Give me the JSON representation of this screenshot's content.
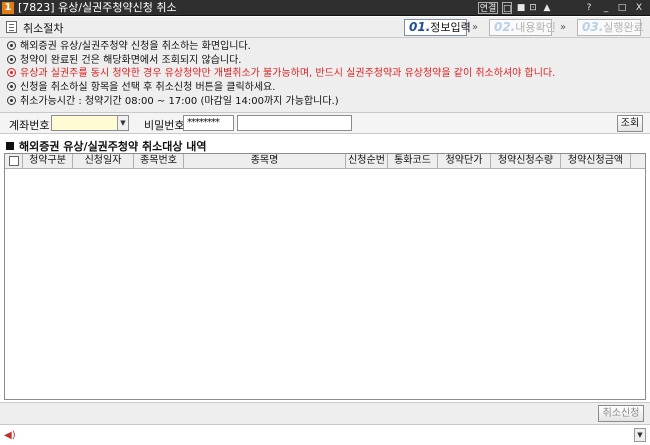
{
  "window": {
    "badge": "1",
    "title": "[7823] 유상/실권주청약신청 취소",
    "controls": [
      "연결",
      "□",
      "■",
      "⊡",
      "▲",
      "?",
      "_",
      "□",
      "X"
    ]
  },
  "header": {
    "title": "취소절차",
    "steps": [
      {
        "num": "01.",
        "label": "정보입력",
        "active": true
      },
      {
        "num": "02.",
        "label": "내용확인",
        "active": false
      },
      {
        "num": "03.",
        "label": "실행완료",
        "active": false
      }
    ]
  },
  "notices": [
    {
      "text": "해외증권 유상/실권주청약 신청을 취소하는 화면입니다.",
      "color": "#111111"
    },
    {
      "text": "청약이 완료된 건은 해당화면에서 조회되지 않습니다.",
      "color": "#111111"
    },
    {
      "text": "유상과 실권주를 동시 청약한 경우 유상청약만 개별취소가 불가능하며, 반드시 실권주청약과 유상청약을 같이 취소하셔야 합니다.",
      "color": "#e02020"
    },
    {
      "text": "신청을 취소하실 항목을 선택 후 취소신청 버튼을 클릭하세요.",
      "color": "#111111"
    },
    {
      "text": "취소가능시간 : 청약기간 08:00 ~ 17:00 (마감일 14:00까지 가능합니다.)",
      "color": "#111111"
    }
  ],
  "form": {
    "account_label": "계좌번호",
    "account_value": "",
    "password_label": "비밀번호",
    "password_value": "********",
    "account_name_value": "",
    "query_button": "조회"
  },
  "section_title": "해외증권 유상/실권주청약 취소대상 내역",
  "table": {
    "columns": [
      "",
      "청약구분",
      "신청일자",
      "종목번호",
      "종목명",
      "신청순번",
      "통화코드",
      "청약단가",
      "청약신청수량",
      "청약신청금액"
    ],
    "rows": []
  },
  "footer": {
    "cancel_button": "취소신청"
  },
  "colors": {
    "title_bar": "#2f2f2f",
    "panel_bg": "#eeeeee",
    "warning_text": "#e02020",
    "active_step": "#1f4f8f",
    "account_field_bg": "#fffbd4"
  }
}
